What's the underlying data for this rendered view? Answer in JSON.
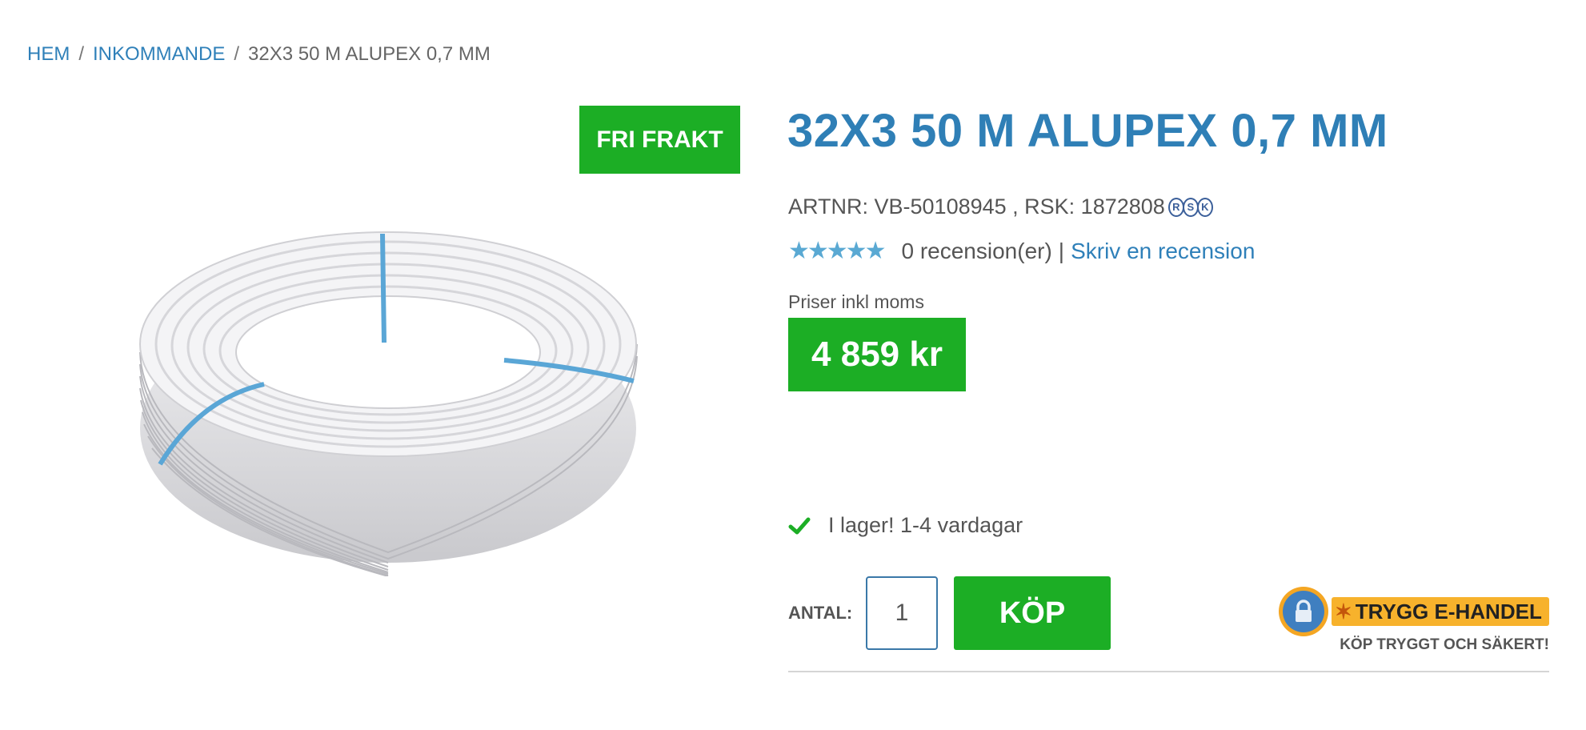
{
  "breadcrumb": {
    "items": [
      "HEM",
      "INKOMMANDE"
    ],
    "separator": "/",
    "current": "32X3 50 M ALUPEX 0,7 MM"
  },
  "product": {
    "badge": "FRI FRAKT",
    "title": "32X3 50 M ALUPEX 0,7 MM",
    "artnr_line": "ARTNR: VB-50108945 , RSK: 1872808",
    "rsk_logo_letters": [
      "R",
      "S",
      "K"
    ],
    "rating": {
      "stars": "★★★★★",
      "value": 0,
      "max": 5,
      "count_text": "0 recension(er)",
      "separator": "|",
      "write_review": "Skriv en recension"
    },
    "price_label": "Priser inkl moms",
    "price": "4 859 kr",
    "stock_text": "I lager! 1-4 vardagar"
  },
  "purchase": {
    "qty_label": "ANTAL:",
    "qty_value": "1",
    "buy_label": "KÖP"
  },
  "trust": {
    "title": "TRYGG  E-HANDEL",
    "subtitle": "KÖP TRYGGT OCH SÄKERT!"
  },
  "colors": {
    "link_blue": "#2f80b9",
    "title_blue": "#2f7fb6",
    "green": "#1cae25",
    "star_blue": "#5aa9d3",
    "trust_orange": "#f7b22c"
  },
  "icons": {
    "check": "check-icon",
    "lock": "lock-icon",
    "star": "star-icon"
  }
}
